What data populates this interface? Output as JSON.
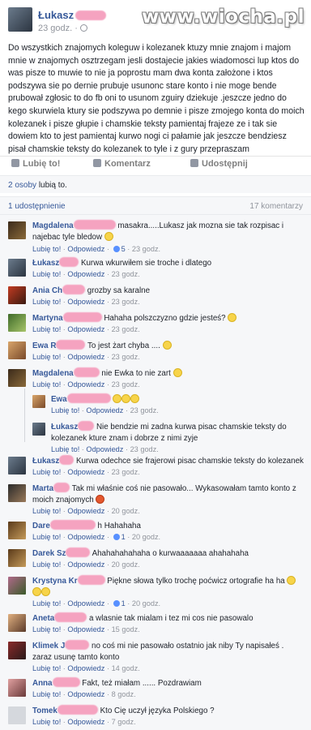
{
  "post": {
    "author": "Łukasz",
    "time": "23 godz.",
    "body": "Do wszystkich znajomych koleguw i kolezanek ktuzy mnie znajom i majom mnie w znajomych osztrzegam jesli dostajecie jakies wiadomosci lup ktos do was pisze to muwie to nie ja poprostu mam dwa konta założone i ktos podszywa sie po dernie prubuje usunonc stare konto i nie moge bende prubował zgłosic to do fb oni to usunom zguiry dziekuje .jeszcze jedno do kego skurwiela ktury sie podszywa po demnie i pisze zmojego konta do moich kolezanek i pisze głupie i chamskie teksty pamientaj frajeze ze i tak sie dowiem kto to jest pamientaj kurwo nogi ci pałamie jak jeszcze bendziesz pisał chamskie teksty do kolezanek to tyle i z gury przepraszam"
  },
  "watermark": "www.wiocha.pl",
  "actions": {
    "like": "Lubię to!",
    "comment": "Komentarz",
    "share": "Udostępnij"
  },
  "likes": {
    "count": "2 osoby",
    "text": "lubią to."
  },
  "shares": {
    "text": "1 udostępnienie",
    "comments_count": "17 komentarzy"
  },
  "comment_meta": {
    "like": "Lubię to!",
    "reply": "Odpowiedz"
  },
  "comments": [
    {
      "name": "Magdalena",
      "text": "masakra.....Lukasz jak mozna sie tak rozpisac i najebac tyle bledow",
      "likes": "5",
      "time": "23 godz."
    },
    {
      "name": "Łukasz",
      "text": "Kurwa wkurwiłem sie troche i dlatego",
      "time": "23 godz."
    },
    {
      "name": "Ania Ch",
      "text": "grozby sa karalne",
      "time": "23 godz."
    },
    {
      "name": "Martyna",
      "text": "Hahaha polszczyzno gdzie jesteś?",
      "time": "23 godz."
    },
    {
      "name": "Ewa R",
      "text": "To jest żart chyba ....",
      "time": "23 godz."
    },
    {
      "name": "Magdalena",
      "text": "nie Ewka to nie zart",
      "time": "23 godz."
    },
    {
      "name": "Ewa",
      "text": "",
      "time": "23 godz."
    },
    {
      "name": "Łukasz",
      "text": "Nie bendzie mi zadna kurwa pisac chamskie teksty do kolezanek kture znam i dobrze z nimi zyje",
      "time": "23 godz."
    },
    {
      "name": "Łukasz",
      "text": "Kurwa odechce sie frajerowi pisac chamskie teksty do kolezanek",
      "time": "23 godz."
    },
    {
      "name": "Marta",
      "text": "Tak mi właśnie coś nie pasowało... Wykasowałam tamto konto z moich znajomych",
      "time": "20 godz."
    },
    {
      "name": "Dare",
      "text": "h Hahahaha",
      "likes": "1",
      "time": "20 godz."
    },
    {
      "name": "Darek Sz",
      "text": "Ahahahahahaha o kurwaaaaaaa ahahahaha",
      "time": "20 godz."
    },
    {
      "name": "Krystyna Kr",
      "text": "Piękne słowa tylko trochę poćwicz ortografie ha ha",
      "likes": "1",
      "time": "20 godz."
    },
    {
      "name": "Aneta",
      "text": "a wlasnie tak mialam i tez mi cos nie pasowalo",
      "time": "15 godz."
    },
    {
      "name": "Klimek J",
      "text": "no coś mi nie pasowało ostatnio jak niby Ty napisałeś . zaraz usunę tamto konto",
      "time": "14 godz."
    },
    {
      "name": "Anna",
      "text": "Fakt, też miałam ...... Pozdrawiam",
      "time": "8 godz."
    },
    {
      "name": "Tomek",
      "text": "Kto Cię uczył języka Polskiego ?",
      "time": "7 godz."
    }
  ],
  "colors": {
    "link": "#365899",
    "meta": "#90949c",
    "background": "#f6f7f9",
    "redaction": "#f5a3c0"
  },
  "icons": [
    "globe-icon",
    "like-icon",
    "comment-icon",
    "share-icon",
    "thumbs-up-icon",
    "emoji-icon"
  ]
}
